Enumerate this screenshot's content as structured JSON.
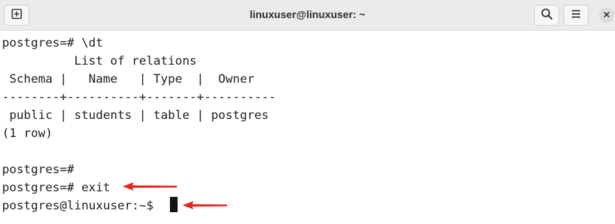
{
  "window": {
    "title": "linuxuser@linuxuser: ~"
  },
  "toolbar": {
    "new_tab_icon": "new-tab-icon",
    "search_icon": "search-icon",
    "menu_icon": "hamburger-menu-icon",
    "close_icon": "close-icon"
  },
  "terminal": {
    "lines": [
      "postgres=# \\dt",
      "          List of relations",
      " Schema |   Name   | Type  |  Owner",
      "--------+----------+-------+----------",
      " public | students | table | postgres",
      "(1 row)",
      "",
      "postgres=#",
      "postgres=# exit",
      "postgres@linuxuser:~$ "
    ]
  },
  "annotations": {
    "arrow_color": "#e8231a"
  }
}
